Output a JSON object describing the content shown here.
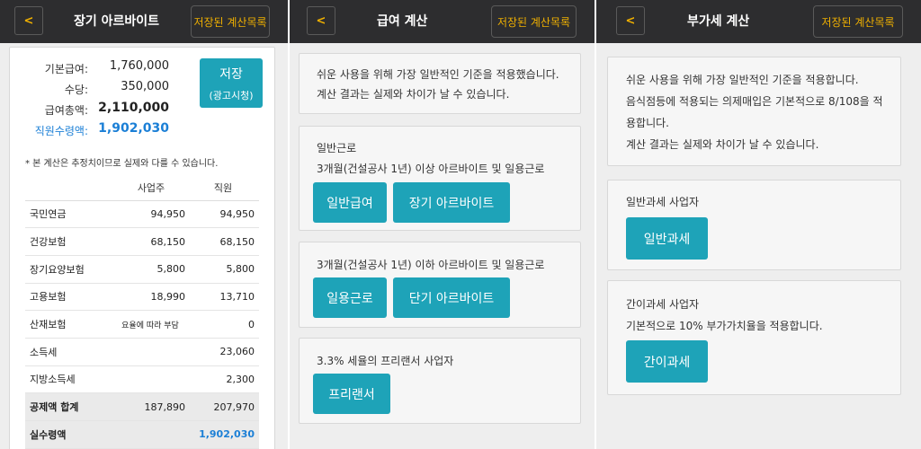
{
  "panel1": {
    "header": {
      "back": "<",
      "title": "장기 아르바이트",
      "saved": "저장된 계산목록"
    },
    "summary": [
      {
        "label": "기본급여:",
        "value": "1,760,000"
      },
      {
        "label": "수당:",
        "value": "350,000"
      },
      {
        "label": "급여총액:",
        "value": "2,110,000"
      },
      {
        "label": "직원수령액:",
        "value": "1,902,030"
      }
    ],
    "save_button": {
      "line1": "저장",
      "line2": "(광고시청)"
    },
    "note": "* 본 계산은 추정치이므로 실제와 다를 수 있습니다.",
    "table": {
      "headers": [
        "",
        "사업주",
        "직원"
      ],
      "rows": [
        [
          "국민연금",
          "94,950",
          "94,950"
        ],
        [
          "건강보험",
          "68,150",
          "68,150"
        ],
        [
          "장기요양보험",
          "5,800",
          "5,800"
        ],
        [
          "고용보험",
          "18,990",
          "13,710"
        ],
        [
          "산재보험",
          "요율에 따라 부담",
          "0"
        ],
        [
          "소득세",
          "",
          "23,060"
        ],
        [
          "지방소득세",
          "",
          "2,300"
        ],
        [
          "공제액 합계",
          "187,890",
          "207,970"
        ],
        [
          "실수령액",
          "",
          "1,902,030"
        ]
      ]
    }
  },
  "panel2": {
    "header": {
      "back": "<",
      "title": "급여 계산",
      "saved": "저장된 계산목록"
    },
    "info": [
      "쉬운 사용을 위해 가장 일반적인 기준을 적용했습니다.",
      "계산 결과는 실제와 차이가 날 수 있습니다."
    ],
    "regular": {
      "title": "일반근로",
      "desc": "3개월(건설공사 1년) 이상 아르바이트 및 일용근로",
      "buttons": [
        "일반급여",
        "장기 아르바이트"
      ]
    },
    "short": {
      "desc": "3개월(건설공사 1년) 이하 아르바이트 및 일용근로",
      "buttons": [
        "일용근로",
        "단기 아르바이트"
      ]
    },
    "freelancer": {
      "desc": "3.3% 세율의 프리랜서 사업자",
      "button": "프리랜서"
    }
  },
  "panel3": {
    "header": {
      "back": "<",
      "title": "부가세 계산",
      "saved": "저장된 계산목록"
    },
    "info": [
      "쉬운 사용을 위해 가장 일반적인 기준을 적용합니다.",
      "음식점등에 적용되는 의제매입은 기본적으로 8/108을 적",
      "용합니다.",
      "계산 결과는 실제와 차이가 날 수 있습니다."
    ],
    "general": {
      "title": "일반과세 사업자",
      "button": "일반과세"
    },
    "simple": {
      "title": "간이과세 사업자",
      "desc": "기본적으로 10% 부가가치율을 적용합니다.",
      "button": "간이과세"
    }
  },
  "colors": {
    "header_bg": "#2d2d2f",
    "accent_yellow": "#f0b000",
    "teal": "#1ea3b8",
    "blue": "#1b7fd6"
  }
}
